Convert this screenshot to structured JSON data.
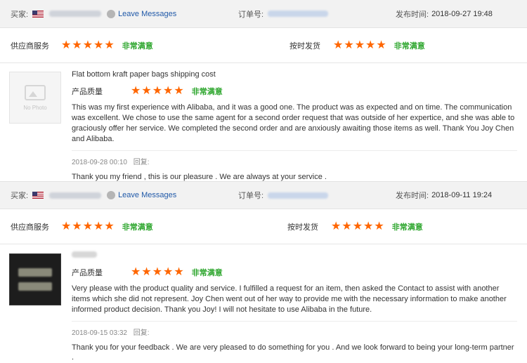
{
  "reviews": [
    {
      "buyer_label": "买家:",
      "leave_messages": "Leave Messages",
      "order_label": "订单号:",
      "time_label": "发布时间:",
      "time_value": "2018-09-27 19:48",
      "supplier_service_label": "供应商服务",
      "supplier_service_stars": 5,
      "supplier_service_text": "非常满意",
      "on_time_label": "按时发货",
      "on_time_stars": 5,
      "on_time_text": "非常满意",
      "thumb_text": "No Photo",
      "product_title": "Flat bottom kraft paper bags shipping cost",
      "quality_label": "产品质量",
      "quality_stars": 5,
      "quality_text": "非常满意",
      "comment": "This was my first experience with Alibaba, and it was a good one. The product was as expected and on time. The communication was excellent. We chose to use the same agent for a second order request that was outside of her expertice, and she was able to graciously offer her service. We completed the second order and are anxiously awaiting those items as well. Thank You Joy Chen and Alibaba.",
      "reply_time": "2018-09-28 00:10",
      "reply_label": "回复:",
      "reply_text": "Thank you my friend , this is our pleasure . We are always at your service ."
    },
    {
      "buyer_label": "买家:",
      "leave_messages": "Leave Messages",
      "order_label": "订单号:",
      "time_label": "发布时间:",
      "time_value": "2018-09-11 19:24",
      "supplier_service_label": "供应商服务",
      "supplier_service_stars": 5,
      "supplier_service_text": "非常满意",
      "on_time_label": "按时发货",
      "on_time_stars": 5,
      "on_time_text": "非常满意",
      "product_title": "",
      "quality_label": "产品质量",
      "quality_stars": 5,
      "quality_text": "非常满意",
      "comment": "Very please with the product quality and service. I fulfilled a request for an item, then asked the Contact to assist with another items which she did not represent. Joy Chen went out of her way to provide me with the necessary information to make another informed product decision. Thank you Joy! I will not hesitate to use Alibaba in the future.",
      "reply_time": "2018-09-15 03:32",
      "reply_label": "回复:",
      "reply_text": "Thank you for your feedback . We are very pleased to do something for you . And we look forward to being your long-term partner ."
    }
  ],
  "colors": {
    "star": "#ff6600",
    "satisfied": "#2ba52b",
    "link": "#2059a8",
    "header_bg": "#f2f2f2"
  }
}
